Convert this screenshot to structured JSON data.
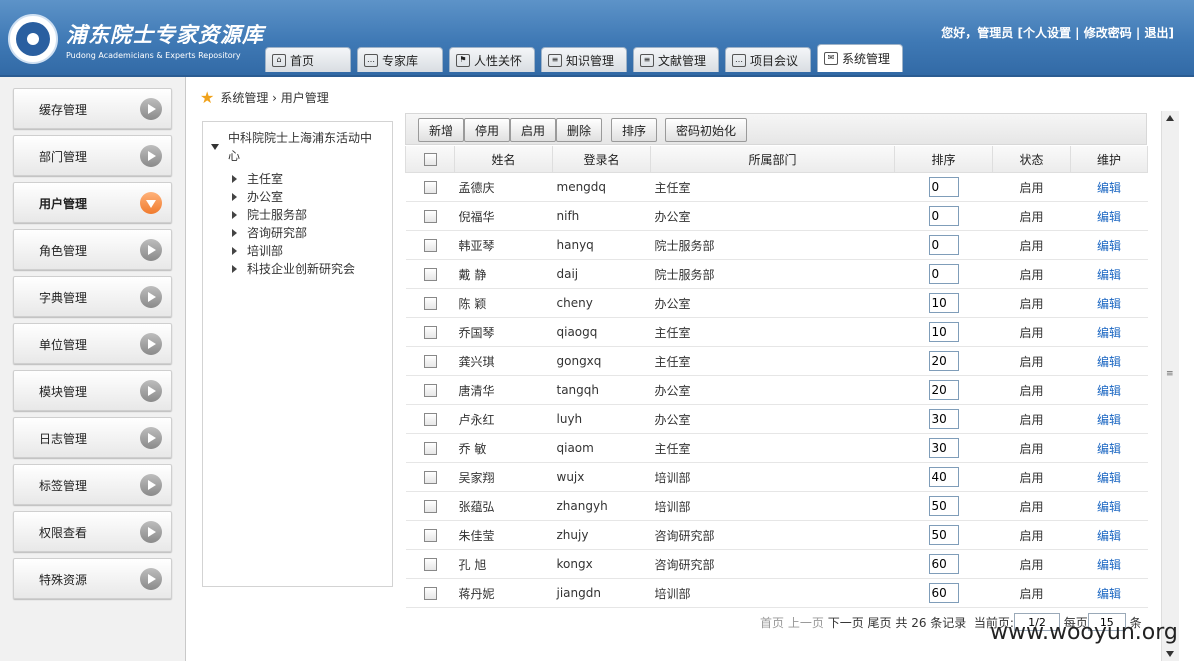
{
  "header": {
    "logo_cn": "浦东院士专家资源库",
    "logo_en": "Pudong Academicians & Experts Repository",
    "user_greeting": "您好，管理员",
    "links": [
      "[个人设置",
      "修改密码",
      "退出]"
    ],
    "tabs": [
      {
        "label": "首页",
        "icon": "home-icon"
      },
      {
        "label": "专家库",
        "icon": "chat-icon"
      },
      {
        "label": "人性关怀",
        "icon": "flag-icon"
      },
      {
        "label": "知识管理",
        "icon": "document-icon"
      },
      {
        "label": "文献管理",
        "icon": "document-icon"
      },
      {
        "label": "项目会议",
        "icon": "chat-icon"
      },
      {
        "label": "系统管理",
        "icon": "mail-icon",
        "active": true
      }
    ]
  },
  "sidebar": {
    "items": [
      {
        "label": "缓存管理"
      },
      {
        "label": "部门管理"
      },
      {
        "label": "用户管理",
        "active": true
      },
      {
        "label": "角色管理"
      },
      {
        "label": "字典管理"
      },
      {
        "label": "单位管理"
      },
      {
        "label": "模块管理"
      },
      {
        "label": "日志管理"
      },
      {
        "label": "标签管理"
      },
      {
        "label": "权限查看"
      },
      {
        "label": "特殊资源"
      }
    ]
  },
  "breadcrumb": "系统管理 › 用户管理",
  "tree": {
    "root": "中科院院士上海浦东活动中心",
    "nodes": [
      "主任室",
      "办公室",
      "院士服务部",
      "咨询研究部",
      "培训部",
      "科技企业创新研究会"
    ]
  },
  "toolbar": {
    "add": "新增",
    "disable": "停用",
    "enable": "启用",
    "delete": "删除",
    "sort": "排序",
    "reset_password": "密码初始化"
  },
  "table": {
    "headers": {
      "name": "姓名",
      "login": "登录名",
      "dept": "所属部门",
      "sort": "排序",
      "status": "状态",
      "action": "维护"
    },
    "rows": [
      {
        "name": "孟德庆",
        "login": "mengdq",
        "dept": "主任室",
        "sort": "0",
        "status": "启用",
        "action": "编辑"
      },
      {
        "name": "倪福华",
        "login": "nifh",
        "dept": "办公室",
        "sort": "0",
        "status": "启用",
        "action": "编辑"
      },
      {
        "name": "韩亚琴",
        "login": "hanyq",
        "dept": "院士服务部",
        "sort": "0",
        "status": "启用",
        "action": "编辑"
      },
      {
        "name": "戴 静",
        "login": "daij",
        "dept": "院士服务部",
        "sort": "0",
        "status": "启用",
        "action": "编辑"
      },
      {
        "name": "陈 颖",
        "login": "cheny",
        "dept": "办公室",
        "sort": "10",
        "status": "启用",
        "action": "编辑"
      },
      {
        "name": "乔国琴",
        "login": "qiaogq",
        "dept": "主任室",
        "sort": "10",
        "status": "启用",
        "action": "编辑"
      },
      {
        "name": "龚兴琪",
        "login": "gongxq",
        "dept": "主任室",
        "sort": "20",
        "status": "启用",
        "action": "编辑"
      },
      {
        "name": "唐清华",
        "login": "tangqh",
        "dept": "办公室",
        "sort": "20",
        "status": "启用",
        "action": "编辑"
      },
      {
        "name": "卢永红",
        "login": "luyh",
        "dept": "办公室",
        "sort": "30",
        "status": "启用",
        "action": "编辑"
      },
      {
        "name": "乔 敏",
        "login": "qiaom",
        "dept": "主任室",
        "sort": "30",
        "status": "启用",
        "action": "编辑"
      },
      {
        "name": "吴家翔",
        "login": "wujx",
        "dept": "培训部",
        "sort": "40",
        "status": "启用",
        "action": "编辑"
      },
      {
        "name": "张蕴弘",
        "login": "zhangyh",
        "dept": "培训部",
        "sort": "50",
        "status": "启用",
        "action": "编辑"
      },
      {
        "name": "朱佳莹",
        "login": "zhujy",
        "dept": "咨询研究部",
        "sort": "50",
        "status": "启用",
        "action": "编辑"
      },
      {
        "name": "孔 旭",
        "login": "kongx",
        "dept": "咨询研究部",
        "sort": "60",
        "status": "启用",
        "action": "编辑"
      },
      {
        "name": "蒋丹妮",
        "login": "jiangdn",
        "dept": "培训部",
        "sort": "60",
        "status": "启用",
        "action": "编辑"
      }
    ]
  },
  "pager": {
    "first": "首页",
    "prev": "上一页",
    "next": "下一页",
    "last": "尾页",
    "total": "共 26 条记录",
    "current_label": "当前页:",
    "current_value": "1/2",
    "per_page_label": "每页",
    "per_page_value": "15",
    "per_page_unit": "条"
  },
  "watermark": "www.wooyun.org",
  "colors": {
    "header": "#3f79b5",
    "active_arrow": "#f07b2e",
    "link": "#1a66c2"
  }
}
